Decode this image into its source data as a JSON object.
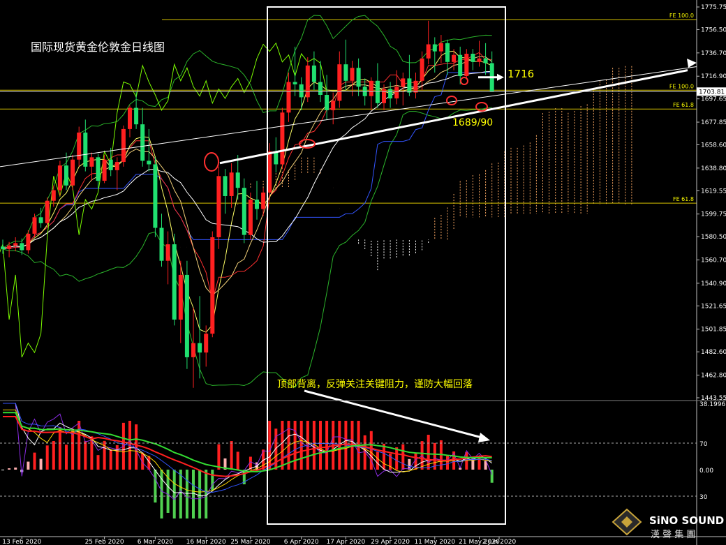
{
  "chart_data": [
    {
      "type": "candlestick",
      "title": "国际现货黄金伦敦金日线图",
      "price_axis": {
        "ylim": [
          1443.55,
          1775.75
        ],
        "ticks": [
          "1775.75",
          "1756.50",
          "1736.70",
          "1716.90",
          "1697.65",
          "1677.85",
          "1658.60",
          "1638.80",
          "1619.55",
          "1599.75",
          "1580.50",
          "1560.70",
          "1540.90",
          "1521.65",
          "1501.85",
          "1482.60",
          "1462.80",
          "1443.55"
        ],
        "current_price": "1703.81"
      },
      "date_ticks": [
        "13 Feb 2020",
        "25 Feb 2020",
        "6 Mar 2020",
        "16 Mar 2020",
        "25 Mar 2020",
        "6 Apr 2020",
        "17 Apr 2020",
        "29 Apr 2020",
        "11 May 2020",
        "21 May 2020",
        "2 Jun 2020"
      ],
      "fib_levels": [
        {
          "label": "FE 100.0",
          "value": 1765
        },
        {
          "label": "FE 100.0",
          "value": 1705
        },
        {
          "label": "FE 61.8",
          "value": 1689
        },
        {
          "label": "FE 61.8",
          "value": 1609
        }
      ],
      "annotations": {
        "resistance_label": "1716",
        "support_label": "1689/90",
        "divergence_note": "顶部背离，反弹关注关键阻力，谨防大幅回落"
      },
      "candles": [
        [
          1572,
          1578,
          1566,
          1570
        ],
        [
          1570,
          1576,
          1563,
          1573
        ],
        [
          1573,
          1580,
          1568,
          1575
        ],
        [
          1575,
          1579,
          1565,
          1569
        ],
        [
          1569,
          1586,
          1566,
          1583
        ],
        [
          1583,
          1600,
          1580,
          1597
        ],
        [
          1597,
          1605,
          1588,
          1592
        ],
        [
          1592,
          1614,
          1589,
          1611
        ],
        [
          1611,
          1624,
          1606,
          1620
        ],
        [
          1620,
          1645,
          1615,
          1641
        ],
        [
          1641,
          1652,
          1620,
          1624
        ],
        [
          1624,
          1650,
          1620,
          1646
        ],
        [
          1646,
          1674,
          1640,
          1669
        ],
        [
          1669,
          1680,
          1636,
          1640
        ],
        [
          1640,
          1652,
          1628,
          1648
        ],
        [
          1648,
          1651,
          1622,
          1628
        ],
        [
          1628,
          1650,
          1626,
          1646
        ],
        [
          1646,
          1656,
          1632,
          1637
        ],
        [
          1637,
          1648,
          1620,
          1644
        ],
        [
          1644,
          1675,
          1640,
          1672
        ],
        [
          1672,
          1692,
          1665,
          1690
        ],
        [
          1690,
          1704,
          1672,
          1676
        ],
        [
          1676,
          1690,
          1640,
          1645
        ],
        [
          1645,
          1672,
          1636,
          1642
        ],
        [
          1642,
          1648,
          1580,
          1588
        ],
        [
          1588,
          1600,
          1555,
          1560
        ],
        [
          1560,
          1585,
          1540,
          1574
        ],
        [
          1574,
          1583,
          1505,
          1510
        ],
        [
          1510,
          1560,
          1490,
          1548
        ],
        [
          1548,
          1560,
          1468,
          1478
        ],
        [
          1478,
          1520,
          1452,
          1490
        ],
        [
          1490,
          1530,
          1460,
          1482
        ],
        [
          1482,
          1505,
          1470,
          1498
        ],
        [
          1498,
          1585,
          1495,
          1580
        ],
        [
          1580,
          1640,
          1570,
          1632
        ],
        [
          1632,
          1638,
          1600,
          1615
        ],
        [
          1615,
          1643,
          1605,
          1635
        ],
        [
          1635,
          1650,
          1612,
          1622
        ],
        [
          1622,
          1630,
          1575,
          1582
        ],
        [
          1582,
          1618,
          1578,
          1612
        ],
        [
          1612,
          1628,
          1595,
          1604
        ],
        [
          1604,
          1622,
          1598,
          1618
        ],
        [
          1618,
          1660,
          1612,
          1653
        ],
        [
          1653,
          1665,
          1635,
          1642
        ],
        [
          1642,
          1690,
          1638,
          1686
        ],
        [
          1686,
          1720,
          1678,
          1712
        ],
        [
          1712,
          1742,
          1700,
          1710
        ],
        [
          1710,
          1716,
          1688,
          1699
        ],
        [
          1699,
          1733,
          1695,
          1726
        ],
        [
          1726,
          1738,
          1705,
          1712
        ],
        [
          1712,
          1730,
          1695,
          1701
        ],
        [
          1701,
          1718,
          1680,
          1688
        ],
        [
          1688,
          1703,
          1676,
          1696
        ],
        [
          1696,
          1738,
          1690,
          1727
        ],
        [
          1727,
          1748,
          1705,
          1713
        ],
        [
          1713,
          1730,
          1700,
          1724
        ],
        [
          1724,
          1732,
          1700,
          1708
        ],
        [
          1708,
          1715,
          1692,
          1700
        ],
        [
          1700,
          1716,
          1688,
          1713
        ],
        [
          1713,
          1728,
          1690,
          1694
        ],
        [
          1694,
          1710,
          1688,
          1706
        ],
        [
          1706,
          1712,
          1690,
          1698
        ],
        [
          1698,
          1722,
          1693,
          1708
        ],
        [
          1708,
          1720,
          1692,
          1715
        ],
        [
          1715,
          1735,
          1700,
          1703
        ],
        [
          1703,
          1720,
          1698,
          1713
        ],
        [
          1713,
          1738,
          1705,
          1732
        ],
        [
          1732,
          1764,
          1727,
          1744
        ],
        [
          1744,
          1750,
          1720,
          1738
        ],
        [
          1738,
          1752,
          1728,
          1745
        ],
        [
          1745,
          1748,
          1718,
          1729
        ],
        [
          1729,
          1740,
          1722,
          1735
        ],
        [
          1735,
          1742,
          1710,
          1717
        ],
        [
          1717,
          1740,
          1714,
          1736
        ],
        [
          1736,
          1740,
          1722,
          1729
        ],
        [
          1729,
          1747,
          1725,
          1732
        ],
        [
          1732,
          1745,
          1718,
          1728
        ],
        [
          1728,
          1738,
          1712,
          1704
        ]
      ]
    },
    {
      "type": "oscillator",
      "ylim": [
        0,
        100
      ],
      "ticks": [
        "38.1996",
        "70",
        "0.00",
        "30"
      ],
      "levels": [
        70,
        30
      ]
    }
  ],
  "watermark": {
    "brand": "SiNO SOUND",
    "sub": "漢 聲 集 團"
  }
}
